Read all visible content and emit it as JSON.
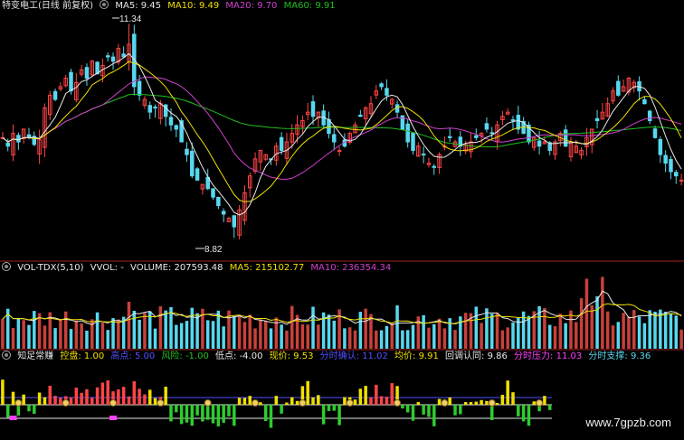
{
  "colors": {
    "up": "#ff4545",
    "up_vol": "#c8413b",
    "down": "#58d8ef",
    "ma5": "#e8e8e8",
    "ma10": "#f0e000",
    "ma20": "#d040d0",
    "ma60": "#20c020",
    "sep": "#a02020",
    "green_bar": "#2ecc2e",
    "yellow_bar": "#f0e000",
    "blue_line": "#5050ff",
    "magenta_mark": "#ff40ff"
  },
  "main_header": {
    "title": "特变电工(日线 前复权)",
    "ma5": "MA5: 9.45",
    "ma10": "MA10: 9.49",
    "ma20": "MA20: 9.70",
    "ma60": "MA60: 9.91"
  },
  "vol_header": {
    "name": "VOL-TDX(5,10)",
    "vvol": "VVOL: -",
    "volume": "VOLUME: 207593.48",
    "ma5": "MA5: 215102.77",
    "ma10": "MA10: 236354.34"
  },
  "ind_header": {
    "name": "知足常赚",
    "kongpan": "控盘: 1.00",
    "gaodian": "高点: 5.00",
    "fengxian": "风险: -1.00",
    "didian": "低点: -4.00",
    "xianjia": "现价: 9.53",
    "fenshi_queren": "分时确认: 11.02",
    "junjia": "均价: 9.91",
    "huidiao": "回调认同: 9.86",
    "yali": "分时压力: 11.03",
    "zhicheng": "分时支撑: 9.36"
  },
  "annotations": {
    "high": "11.34",
    "low": "8.82"
  },
  "watermark": "www.7gpzb.com",
  "chart_data": {
    "type": "candlestick",
    "title": "特变电工(日线 前复权)",
    "y_range": [
      8.6,
      11.45
    ],
    "high_mark": 11.34,
    "low_mark": 8.82,
    "series_close": [
      10.0,
      9.9,
      10.05,
      9.95,
      10.1,
      10.0,
      9.92,
      9.98,
      10.35,
      10.5,
      10.45,
      10.6,
      10.7,
      10.55,
      10.65,
      10.8,
      10.7,
      10.9,
      10.75,
      10.85,
      10.95,
      10.9,
      11.05,
      10.95,
      11.1,
      10.6,
      10.5,
      10.45,
      10.3,
      10.35,
      10.4,
      10.25,
      10.15,
      10.1,
      9.95,
      9.8,
      9.55,
      9.5,
      9.45,
      9.4,
      9.3,
      9.2,
      9.1,
      9.05,
      8.95,
      9.15,
      9.35,
      9.55,
      9.75,
      9.85,
      9.8,
      9.75,
      9.9,
      9.85,
      9.95,
      10.05,
      10.15,
      10.2,
      10.3,
      10.25,
      10.3,
      10.15,
      10.05,
      9.95,
      9.85,
      9.9,
      10.05,
      10.15,
      10.25,
      10.35,
      10.4,
      10.55,
      10.6,
      10.5,
      10.45,
      10.3,
      10.1,
      9.95,
      9.85,
      9.9,
      9.8,
      9.7,
      9.65,
      9.8,
      9.9,
      10.0,
      9.95,
      9.9,
      9.92,
      9.95,
      10.0,
      10.05,
      10.1,
      10.05,
      10.15,
      10.25,
      10.3,
      10.2,
      10.1,
      10.05,
      9.95,
      10.0,
      9.9,
      9.95,
      9.85,
      9.95,
      10.05,
      9.9,
      9.95,
      9.9,
      9.85,
      10.0,
      10.1,
      10.2,
      10.3,
      10.4,
      10.55,
      10.5,
      10.6,
      10.7,
      10.65,
      10.55,
      10.4,
      10.2,
      10.0,
      9.8,
      9.7,
      9.6,
      9.55,
      9.5
    ],
    "ma5": 9.45,
    "ma10": 9.49,
    "ma20": 9.7,
    "ma60": 9.91,
    "volume_latest": 207593.48,
    "volume_ma5": 215102.77,
    "volume_ma10": 236354.34
  }
}
